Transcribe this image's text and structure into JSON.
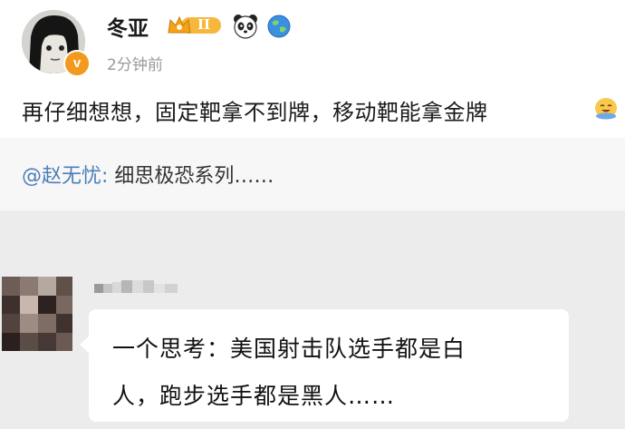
{
  "post": {
    "username": "冬亚",
    "vip_label": "II",
    "avatar_badge": "v",
    "timestamp": "2分钟前",
    "text": "再仔细想想，固定靶拿不到牌，移动靶能拿金牌",
    "icons": [
      "crown-vip-icon",
      "panda-icon",
      "globe-icon",
      "grinning-face-icon"
    ],
    "accent_color": "#f39a1e"
  },
  "repost": {
    "mention": "@赵无忧",
    "separator": ":",
    "text": " 细思极恐系列……",
    "mention_color": "#4a7fb8"
  },
  "chat": {
    "message_line1": "一个思考：美国射击队选手都是白",
    "message_line2": "人，跑步选手都是黑人……"
  }
}
